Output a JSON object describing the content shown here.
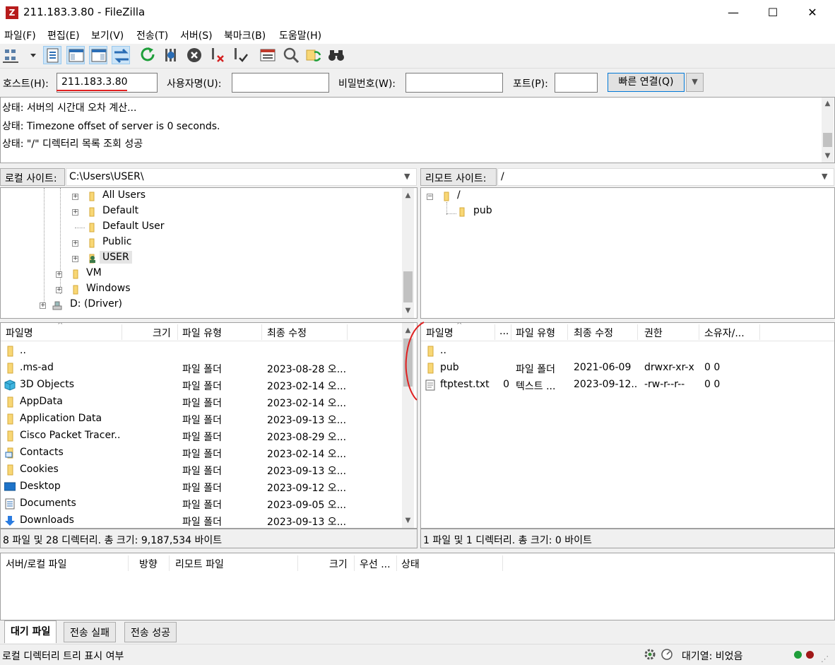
{
  "window": {
    "title": "211.183.3.80 - FileZilla",
    "app_icon_letter": "Z",
    "minimize": "—",
    "maximize": "☐",
    "close": "✕"
  },
  "menu": [
    "파일(F)",
    "편집(E)",
    "보기(V)",
    "전송(T)",
    "서버(S)",
    "북마크(B)",
    "도움말(H)"
  ],
  "quickconnect": {
    "host_label": "호스트(H):",
    "host_value": "211.183.3.80",
    "user_label": "사용자명(U):",
    "user_value": "",
    "pass_label": "비밀번호(W):",
    "pass_value": "",
    "port_label": "포트(P):",
    "port_value": "",
    "connect_label": "빠른 연결(Q)",
    "dropdown": "▼"
  },
  "log": [
    "상태:  서버의 시간대 오차 계산...",
    "상태:  Timezone offset of server is 0 seconds.",
    "상태:  \"/\" 디렉터리 목록 조회 성공"
  ],
  "local": {
    "site_label": "로컬 사이트:",
    "path": "C:\\Users\\USER\\",
    "tree": [
      {
        "label": "All Users",
        "expand": "+"
      },
      {
        "label": "Default",
        "expand": "+"
      },
      {
        "label": "Default User",
        "expand": ""
      },
      {
        "label": "Public",
        "expand": "+"
      },
      {
        "label": "USER",
        "expand": "+"
      },
      {
        "label": "VM",
        "expand": "+"
      },
      {
        "label": "Windows",
        "expand": "+"
      },
      {
        "label": "D: (Driver)",
        "expand": "+"
      }
    ],
    "columns": {
      "name": "파일명",
      "size": "크기",
      "type": "파일 유형",
      "modified": "최종 수정"
    },
    "files": [
      {
        "name": "..",
        "type": "",
        "modified": "",
        "icon": "folder"
      },
      {
        "name": ".ms-ad",
        "type": "파일 폴더",
        "modified": "2023-08-28 오...",
        "icon": "folder"
      },
      {
        "name": "3D Objects",
        "type": "파일 폴더",
        "modified": "2023-02-14 오...",
        "icon": "cube"
      },
      {
        "name": "AppData",
        "type": "파일 폴더",
        "modified": "2023-02-14 오...",
        "icon": "folder"
      },
      {
        "name": "Application Data",
        "type": "파일 폴더",
        "modified": "2023-09-13 오...",
        "icon": "folder"
      },
      {
        "name": "Cisco Packet Tracer...",
        "type": "파일 폴더",
        "modified": "2023-08-29 오...",
        "icon": "folder"
      },
      {
        "name": "Contacts",
        "type": "파일 폴더",
        "modified": "2023-02-14 오...",
        "icon": "contacts"
      },
      {
        "name": "Cookies",
        "type": "파일 폴더",
        "modified": "2023-09-13 오...",
        "icon": "folder"
      },
      {
        "name": "Desktop",
        "type": "파일 폴더",
        "modified": "2023-09-12 오...",
        "icon": "desktop"
      },
      {
        "name": "Documents",
        "type": "파일 폴더",
        "modified": "2023-09-05 오...",
        "icon": "document"
      },
      {
        "name": "Downloads",
        "type": "파일 폴더",
        "modified": "2023-09-13 오...",
        "icon": "download"
      }
    ],
    "status": "8 파일 및 28 디렉터리. 총 크기: 9,187,534 바이트"
  },
  "remote": {
    "site_label": "리모트 사이트:",
    "path": "/",
    "tree": [
      {
        "label": "/",
        "expand": "−"
      },
      {
        "label": "pub",
        "expand": ""
      }
    ],
    "columns": {
      "name": "파일명",
      "size": "...",
      "type": "파일 유형",
      "modified": "최종 수정",
      "perm": "권한",
      "owner": "소유자/..."
    },
    "files": [
      {
        "name": "..",
        "size": "",
        "type": "",
        "modified": "",
        "perm": "",
        "owner": "",
        "icon": "folder"
      },
      {
        "name": "pub",
        "size": "",
        "type": "파일 폴더",
        "modified": "2021-06-09",
        "perm": "drwxr-xr-x",
        "owner": "0 0",
        "icon": "folder"
      },
      {
        "name": "ftptest.txt",
        "size": "0",
        "type": "텍스트 ...",
        "modified": "2023-09-12...",
        "perm": "-rw-r--r--",
        "owner": "0 0",
        "icon": "text"
      }
    ],
    "status": "1 파일 및 1 디렉터리. 총 크기: 0 바이트"
  },
  "queue": {
    "columns": [
      "서버/로컬 파일",
      "방향",
      "리모트 파일",
      "크기",
      "우선 ...",
      "상태"
    ],
    "tabs": [
      "대기 파일",
      "전송 실패",
      "전송 성공"
    ]
  },
  "statusbar": {
    "left": "로컬 디렉터리 트리 표시 여부",
    "queue": "대기열: 비었음"
  },
  "colors": {
    "folder": "#f8d775",
    "accent": "#0078d7",
    "annotation": "#e02020"
  }
}
